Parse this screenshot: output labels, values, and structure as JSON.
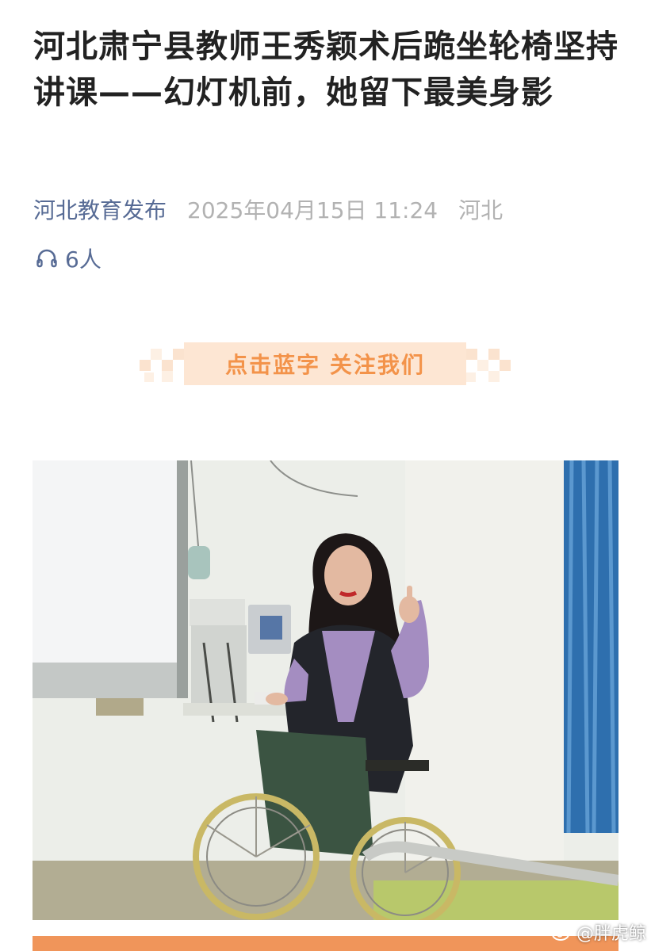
{
  "article": {
    "title": "河北肃宁县教师王秀颖术后跪坐轮椅坚持讲课——幻灯机前，她留下最美身影",
    "source": "河北教育发布",
    "date": "2025年04月15日 11:24",
    "region": "河北",
    "listen_count": "6人"
  },
  "banner": {
    "text": "点击蓝字 关注我们"
  },
  "watermark": {
    "text": "@胖虎鲸"
  },
  "colors": {
    "link": "#576b95",
    "meta": "#b2b2b2",
    "banner_text": "#f3934a",
    "banner_bg": "#fde6d3"
  },
  "icons": [
    "headphones-icon",
    "weibo-icon"
  ]
}
